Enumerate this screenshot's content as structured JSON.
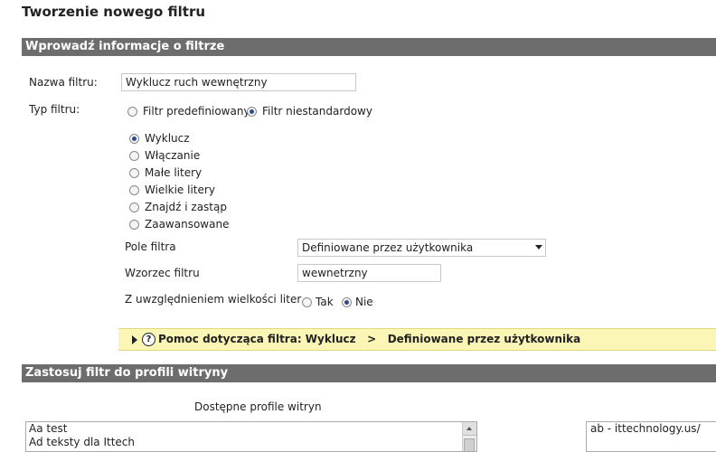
{
  "page_title": "Tworzenie nowego filtru",
  "section1": {
    "header": "Wprowadź informacje o filtrze"
  },
  "form": {
    "filter_name_label": "Nazwa filtru:",
    "filter_name_value": "Wyklucz ruch wewnętrzny",
    "filter_type_label": "Typ filtru:",
    "type_options": [
      {
        "label": "Filtr predefiniowany",
        "selected": false
      },
      {
        "label": "Filtr niestandardowy",
        "selected": true
      }
    ],
    "custom_options": [
      {
        "label": "Wyklucz",
        "selected": true
      },
      {
        "label": "Włączanie",
        "selected": false
      },
      {
        "label": "Małe litery",
        "selected": false
      },
      {
        "label": "Wielkie litery",
        "selected": false
      },
      {
        "label": "Znajdź i zastąp",
        "selected": false
      },
      {
        "label": "Zaawansowane",
        "selected": false
      }
    ],
    "filter_field_label": "Pole filtra",
    "filter_field_value": "Definiowane przez użytkownika",
    "filter_pattern_label": "Wzorzec filtru",
    "filter_pattern_value": "wewnetrzny",
    "case_label": "Z uwzględnieniem wielkości liter",
    "case_options": [
      {
        "label": "Tak",
        "selected": false
      },
      {
        "label": "Nie",
        "selected": true
      }
    ]
  },
  "help": {
    "text": "Pomoc dotycząca filtra: Wyklucz   >   Definiowane przez użytkownika",
    "icon": "question-circle-icon"
  },
  "section2": {
    "header": "Zastosuj filtr do profili witryny",
    "available_label": "Dostępne profile witryn",
    "available_items": [
      "Aa test",
      "Ad teksty dla Ittech"
    ],
    "selected_items": [
      "ab - ittechnology.us/"
    ]
  },
  "colors": {
    "section_header_bg": "#6d6d6d",
    "help_bg": "#fbf5b6",
    "radio_dot": "#2d4c8a"
  }
}
